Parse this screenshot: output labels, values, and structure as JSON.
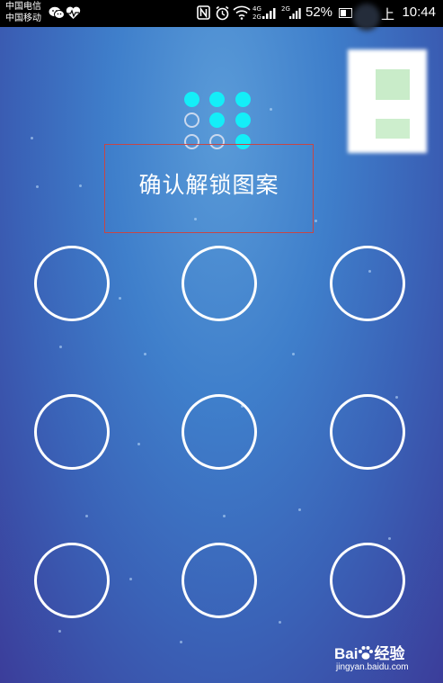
{
  "status_bar": {
    "carrier_1": "中国电信",
    "carrier_2": "中国移动",
    "sim1_network": "4G",
    "sim1_network2": "2G",
    "sim2_network": "2G",
    "battery_percent": "52%",
    "time_prefix": "上",
    "time": "10:44",
    "icons": [
      "wechat-icon",
      "health-icon",
      "nfc-icon",
      "alarm-icon",
      "wifi-icon",
      "signal-icon",
      "battery-icon"
    ]
  },
  "header": {
    "title": "确认解锁图案",
    "preview_pattern": [
      [
        true,
        true,
        true
      ],
      [
        false,
        true,
        true
      ],
      [
        false,
        false,
        true
      ]
    ],
    "accent_color": "#14eef8"
  },
  "pattern_grid": {
    "rows": 3,
    "cols": 3,
    "node_color": "#ffffff"
  },
  "watermark": {
    "brand": "Bai",
    "brand_suffix": "经验",
    "url": "jingyan.baidu.com"
  }
}
